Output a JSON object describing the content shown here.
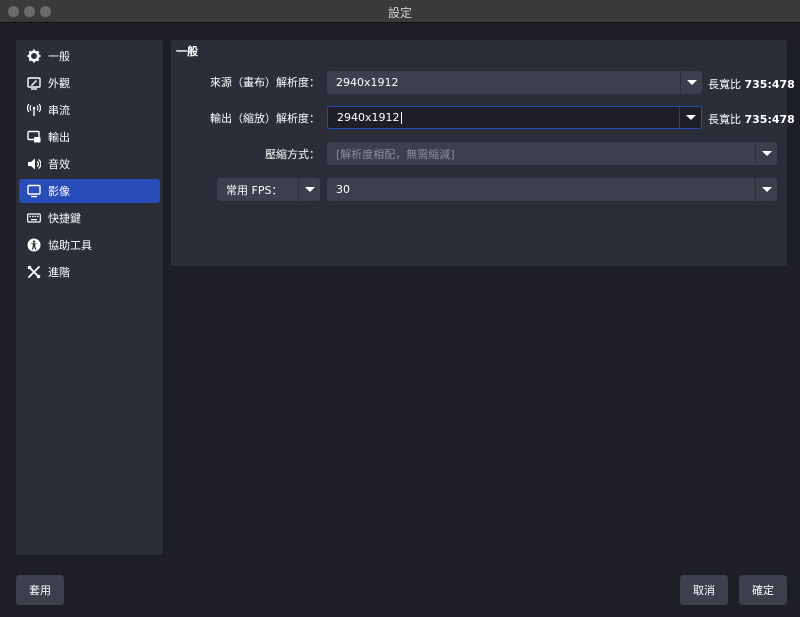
{
  "window": {
    "title": "設定"
  },
  "sidebar": {
    "items": [
      {
        "label": "一般",
        "icon": "gear-icon"
      },
      {
        "label": "外觀",
        "icon": "appearance-icon"
      },
      {
        "label": "串流",
        "icon": "stream-antenna-icon"
      },
      {
        "label": "輸出",
        "icon": "output-icon"
      },
      {
        "label": "音效",
        "icon": "speaker-icon"
      },
      {
        "label": "影像",
        "icon": "monitor-icon",
        "active": true
      },
      {
        "label": "快捷鍵",
        "icon": "keyboard-icon"
      },
      {
        "label": "協助工具",
        "icon": "accessibility-icon"
      },
      {
        "label": "進階",
        "icon": "tools-icon"
      }
    ]
  },
  "panel": {
    "section_title": "一般",
    "base_resolution": {
      "label": "來源（畫布）解析度：",
      "value": "2940x1912",
      "aspect_prefix": "長寬比",
      "aspect_value": "735:478"
    },
    "output_resolution": {
      "label": "輸出（縮放）解析度：",
      "value": "2940x1912",
      "aspect_prefix": "長寬比",
      "aspect_value": "735:478"
    },
    "downscale": {
      "label": "壓縮方式：",
      "value": "[解析度相配，無需縮減]"
    },
    "fps": {
      "type_value": "常用 FPS：",
      "value": "30"
    }
  },
  "buttons": {
    "apply": "套用",
    "cancel": "取消",
    "ok": "確定"
  },
  "colors": {
    "accent": "#284cb8",
    "background": "#1e1f26",
    "panel": "#2b2e38",
    "control": "#3c404d"
  }
}
